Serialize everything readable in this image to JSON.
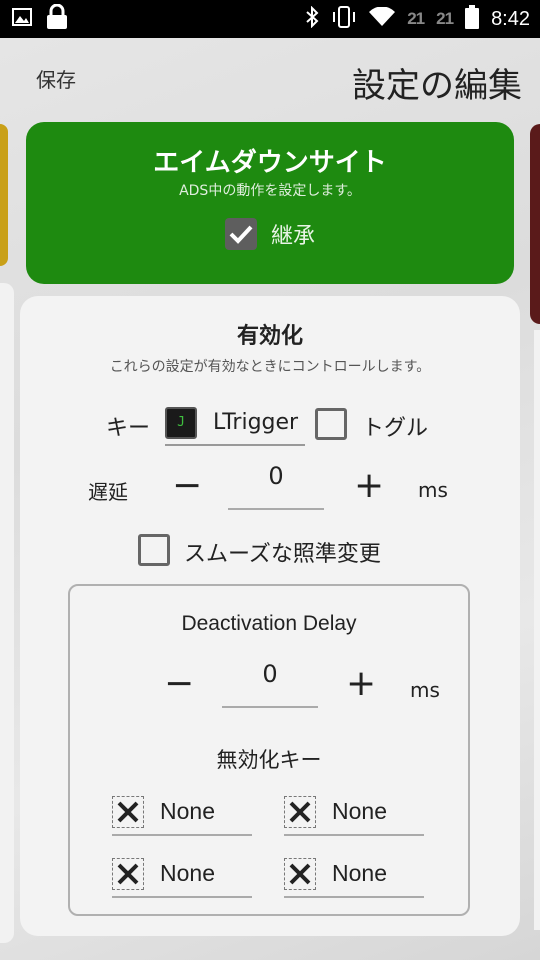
{
  "status_bar": {
    "time": "8:42",
    "sim1": "21",
    "sim2": "21",
    "icons": [
      "image-icon",
      "lock-icon",
      "bluetooth-icon",
      "vibrate-icon",
      "wifi-icon",
      "battery-icon"
    ]
  },
  "header": {
    "save_label": "保存",
    "title": "設定の編集"
  },
  "ads_card": {
    "title": "エイムダウンサイト",
    "subtitle": "ADS中の動作を設定します。",
    "inherit_label": "継承",
    "inherit_checked": true,
    "color": "#1e8a10"
  },
  "activation": {
    "title": "有効化",
    "subtitle": "これらの設定が有効なときにコントロールします。",
    "key_label": "キー",
    "key_icon_text": "J",
    "key_value": "LTrigger",
    "toggle_label": "トグル",
    "toggle_checked": false,
    "delay_label": "遅延",
    "delay_value": "0",
    "delay_unit": "ms",
    "minus": "−",
    "plus": "+",
    "smooth_label": "スムーズな照準変更",
    "smooth_checked": false
  },
  "deactivation": {
    "title": "Deactivation Delay",
    "delay_value": "0",
    "delay_unit": "ms",
    "disable_keys_title": "無効化キー",
    "keys": [
      "None",
      "None",
      "None",
      "None"
    ]
  }
}
